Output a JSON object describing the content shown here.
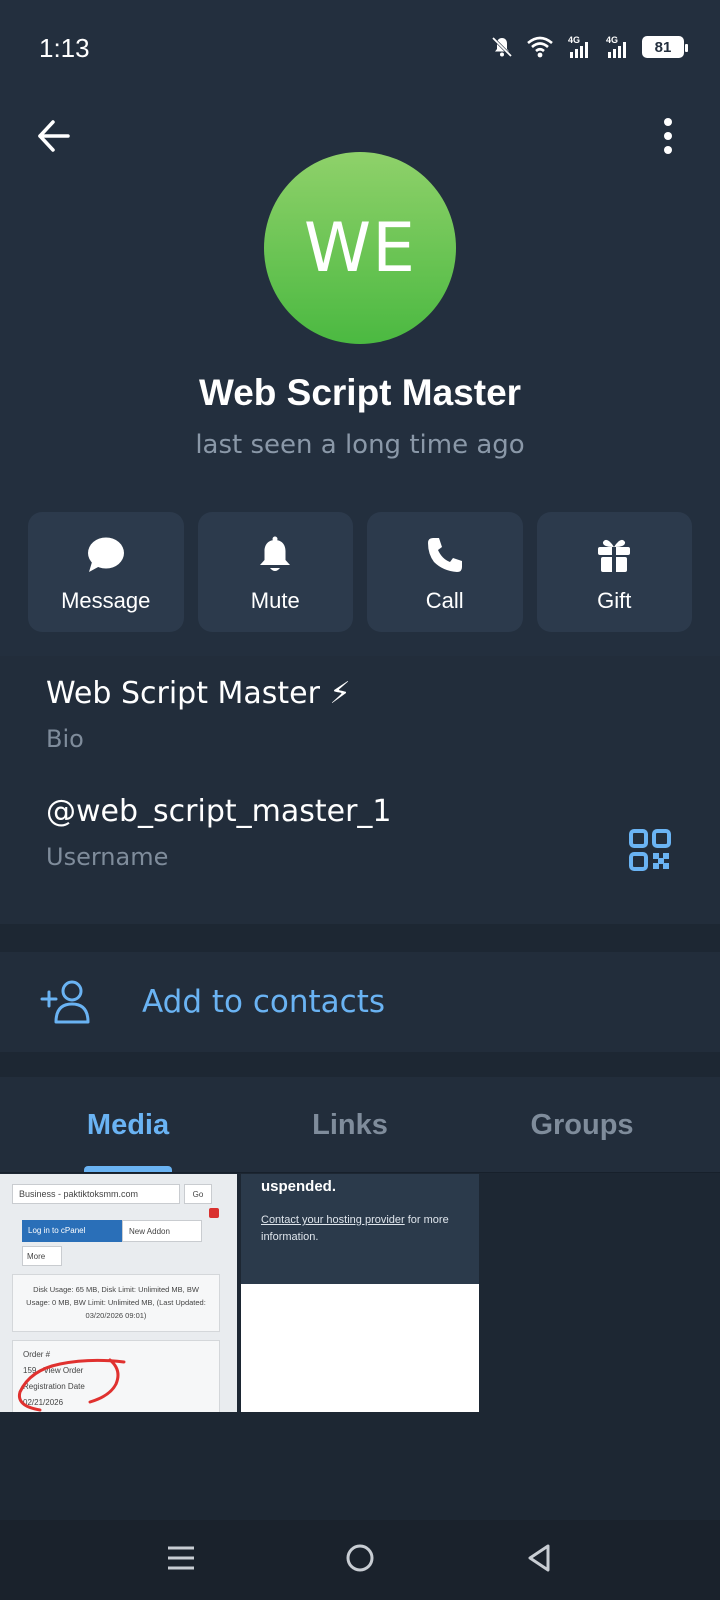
{
  "status_bar": {
    "time": "1:13",
    "battery": "81",
    "network_1": "4G",
    "network_2": "4G"
  },
  "profile": {
    "avatar_initials": "WE",
    "avatar_color": "#4bb941",
    "name": "Web Script Master",
    "status": "last seen a long time ago"
  },
  "actions": [
    {
      "label": "Message",
      "icon": "message-icon"
    },
    {
      "label": "Mute",
      "icon": "bell-icon"
    },
    {
      "label": "Call",
      "icon": "phone-icon"
    },
    {
      "label": "Gift",
      "icon": "gift-icon"
    }
  ],
  "info": {
    "bio_value": "Web Script Master ⚡",
    "bio_label": "Bio",
    "username_value": "@web_script_master_1",
    "username_label": "Username"
  },
  "add_contact": {
    "label": "Add to contacts"
  },
  "tabs": [
    {
      "label": "Media",
      "active": true
    },
    {
      "label": "Links",
      "active": false
    },
    {
      "label": "Groups",
      "active": false
    }
  ],
  "media": {
    "thumb1": {
      "domain_select": "Business - paktiktoksmm.com",
      "go": "Go",
      "login_button": "Log in to cPanel",
      "addon_button": "New Addon",
      "more_button": "More",
      "usage_text": "Disk Usage: 65 MB, Disk Limit: Unlimited MB, BW Usage: 0 MB, BW Limit: Unlimited MB, (Last Updated: 03/20/2026 09:01)",
      "order_label": "Order #",
      "order_value": "159 - View Order",
      "reg_label": "Registration Date",
      "reg_value": "02/21/2026"
    },
    "thumb2": {
      "title": "uspended.",
      "link_text": "Contact your hosting provider",
      "body_text": "for more information."
    }
  },
  "accent_color": "#6ab3f3"
}
